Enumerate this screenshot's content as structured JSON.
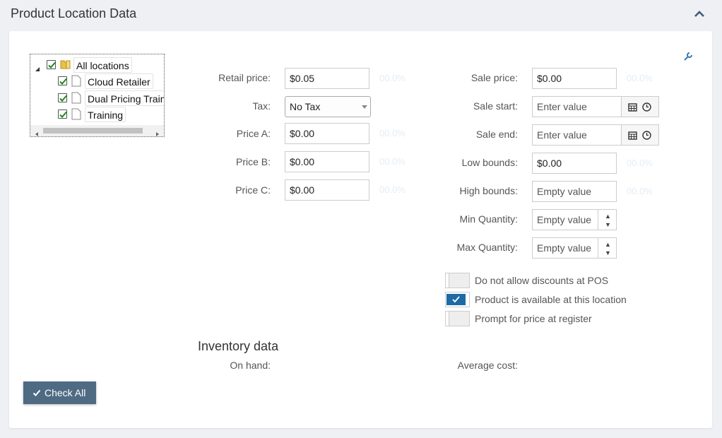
{
  "header": {
    "title": "Product Location Data"
  },
  "tree": {
    "root": {
      "label": "All locations",
      "checked": true
    },
    "children": [
      {
        "label": "Cloud Retailer",
        "checked": true
      },
      {
        "label": "Dual Pricing Training",
        "checked": true
      },
      {
        "label": "Training",
        "checked": true
      }
    ]
  },
  "left_form": {
    "retail_price": {
      "label": "Retail price:",
      "value": "$0.05",
      "pct": "00.0%"
    },
    "tax": {
      "label": "Tax:",
      "value": "No Tax"
    },
    "price_a": {
      "label": "Price A:",
      "value": "$0.00",
      "pct": "00.0%"
    },
    "price_b": {
      "label": "Price B:",
      "value": "$0.00",
      "pct": "00.0%"
    },
    "price_c": {
      "label": "Price C:",
      "value": "$0.00",
      "pct": "00.0%"
    }
  },
  "right_form": {
    "sale_price": {
      "label": "Sale price:",
      "value": "$0.00",
      "pct": "00.0%"
    },
    "sale_start": {
      "label": "Sale start:",
      "placeholder": "Enter value"
    },
    "sale_end": {
      "label": "Sale end:",
      "placeholder": "Enter value"
    },
    "low_bounds": {
      "label": "Low bounds:",
      "value": "$0.00",
      "pct": "00.0%"
    },
    "high_bounds": {
      "label": "High bounds:",
      "placeholder": "Empty value",
      "pct": "00.0%"
    },
    "min_quantity": {
      "label": "Min Quantity:",
      "placeholder": "Empty value"
    },
    "max_quantity": {
      "label": "Max Quantity:",
      "placeholder": "Empty value"
    }
  },
  "toggles": [
    {
      "label": "Do not allow discounts at POS",
      "on": false
    },
    {
      "label": "Product is available at this location",
      "on": true
    },
    {
      "label": "Prompt for price at register",
      "on": false
    }
  ],
  "inventory": {
    "title": "Inventory data",
    "on_hand_label": "On hand:",
    "average_cost_label": "Average cost:"
  },
  "check_all_button": {
    "label": "Check All"
  },
  "colors": {
    "accent": "#1d6aa5",
    "button": "#4f6b83",
    "background": "#eef0f3"
  }
}
